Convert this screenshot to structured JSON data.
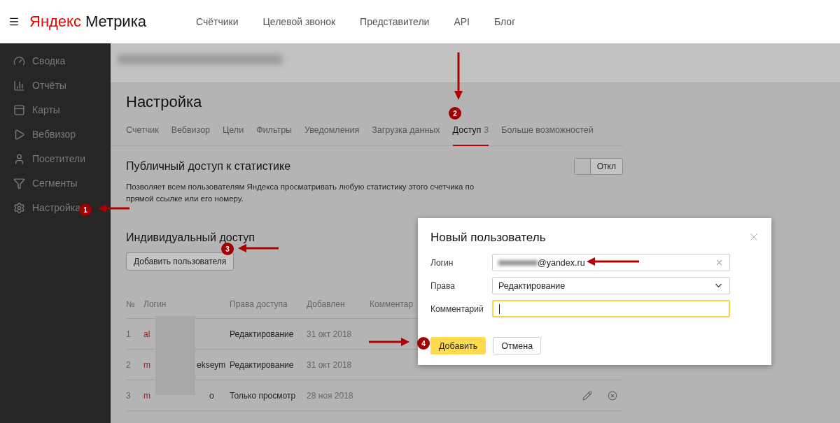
{
  "header": {
    "logo": {
      "brand": "Яндекс",
      "product": "Метрика"
    },
    "nav": [
      "Счётчики",
      "Целевой звонок",
      "Представители",
      "API",
      "Блог"
    ]
  },
  "sidebar": {
    "items": [
      {
        "label": "Сводка"
      },
      {
        "label": "Отчёты"
      },
      {
        "label": "Карты"
      },
      {
        "label": "Вебвизор"
      },
      {
        "label": "Посетители"
      },
      {
        "label": "Сегменты"
      },
      {
        "label": "Настройка"
      }
    ]
  },
  "page": {
    "title": "Настройка",
    "tabs": [
      {
        "label": "Счетчик",
        "selected": false
      },
      {
        "label": "Вебвизор",
        "selected": false
      },
      {
        "label": "Цели",
        "selected": false
      },
      {
        "label": "Фильтры",
        "selected": false
      },
      {
        "label": "Уведомления",
        "selected": false
      },
      {
        "label": "Загрузка данных",
        "selected": false
      },
      {
        "label": "Доступ",
        "count": "3",
        "selected": true
      },
      {
        "label": "Больше возможностей",
        "selected": false
      }
    ]
  },
  "public_access": {
    "title": "Публичный доступ к статистике",
    "description": "Позволяет всем пользователям Яндекса просматривать любую статистику этого счетчика по прямой ссылке или его номеру.",
    "toggle": {
      "label": "Откл",
      "on": false
    }
  },
  "individual_access": {
    "title": "Индивидуальный доступ",
    "add_button": "Добавить пользователя",
    "table": {
      "columns": [
        "№",
        "Логин",
        "Права доступа",
        "Добавлен",
        "Комментар"
      ],
      "rows": [
        {
          "number": "1",
          "login_start": "al",
          "rights": "Редактирование",
          "added": "31 окт 2018"
        },
        {
          "number": "2",
          "login_start": "m",
          "login_end": "ekseym",
          "rights": "Редактирование",
          "added": "31 окт 2018"
        },
        {
          "number": "3",
          "login_start": "m",
          "login_end": "o",
          "rights": "Только просмотр",
          "added": "28 ноя 2018",
          "actions": true
        }
      ]
    }
  },
  "dialog": {
    "title": "Новый пользователь",
    "fields": [
      {
        "kind": "text",
        "label": "Логин",
        "value": "@yandex.ru"
      },
      {
        "kind": "select",
        "label": "Права",
        "value": "Редактирование"
      },
      {
        "kind": "text",
        "label": "Комментарий",
        "focused": true
      }
    ],
    "buttons": [
      {
        "label": "Добавить",
        "primary": true
      },
      {
        "label": "Отмена",
        "primary": false
      }
    ]
  },
  "annotations": [
    "1",
    "2",
    "3",
    "4"
  ]
}
